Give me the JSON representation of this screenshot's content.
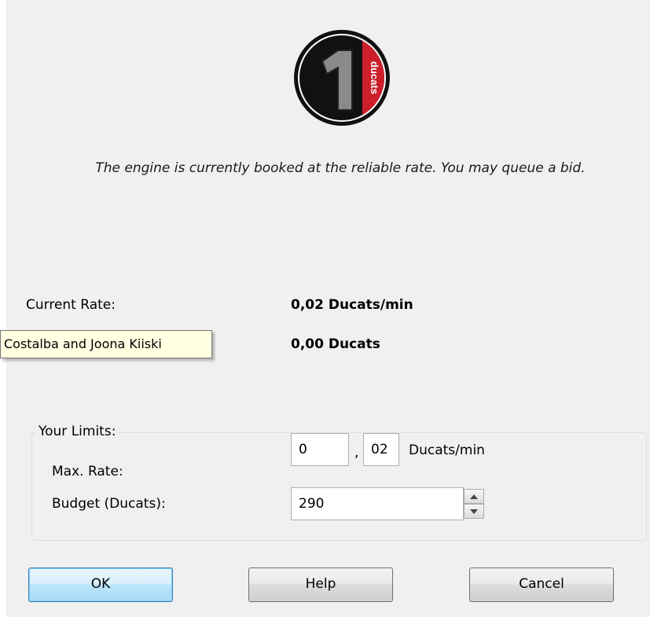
{
  "logo": {
    "number": "1",
    "brand_text": "ducats"
  },
  "message": "The engine is currently booked at the reliable rate. You may queue a bid.",
  "current_rate": {
    "label": "Current Rate:",
    "value": "0,02 Ducats/min"
  },
  "balance": {
    "value": "0,00 Ducats"
  },
  "tooltip": {
    "text": "Costalba and Joona Kiiski"
  },
  "limits": {
    "title": "Your Limits:",
    "max_rate_label": "Max. Rate:",
    "max_rate_whole": "0",
    "max_rate_separator": ",",
    "max_rate_fraction": "02",
    "max_rate_unit": "Ducats/min",
    "budget_label": "Budget (Ducats):",
    "budget_value": "290"
  },
  "buttons": {
    "ok": "OK",
    "help": "Help",
    "cancel": "Cancel"
  },
  "colors": {
    "logo_red": "#cc1f2a",
    "logo_black": "#111111",
    "dialog_bg": "#f0f0f0",
    "tooltip_bg": "#ffffe1",
    "default_button": "#3c7fb1"
  }
}
